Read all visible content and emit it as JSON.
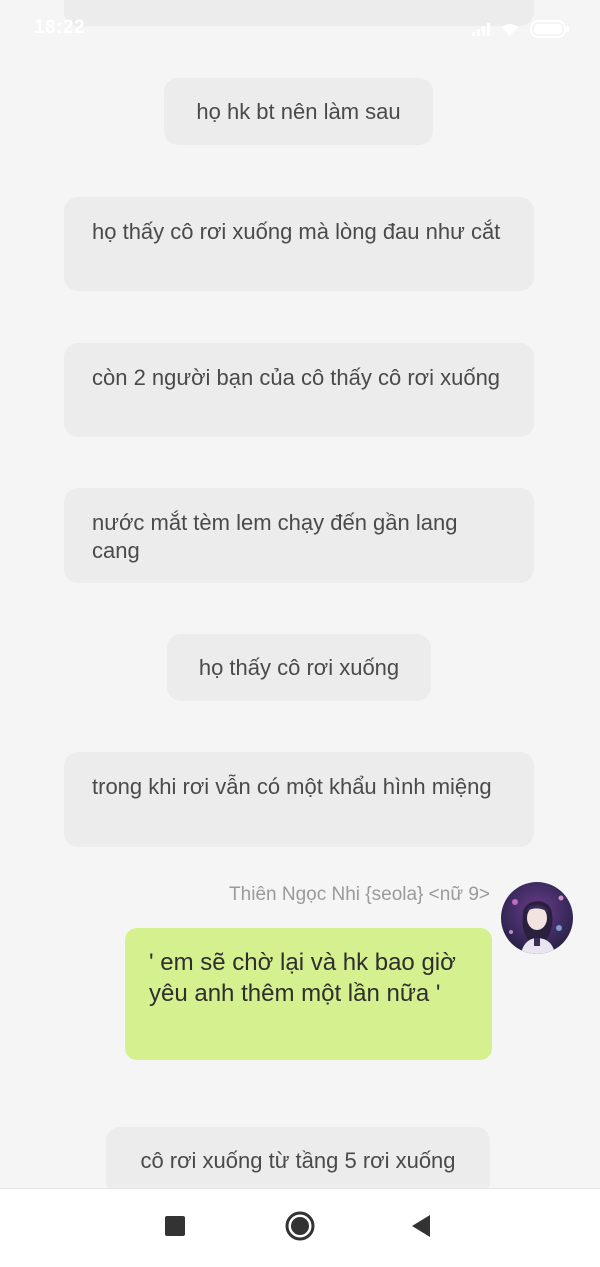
{
  "status_bar": {
    "time": "18:22",
    "signal_icon": "signal-icon",
    "wifi_icon": "wifi-icon",
    "battery_icon": "battery-icon"
  },
  "chat": {
    "messages": [
      {
        "text": "họ hk bt nên làm sau"
      },
      {
        "text": "họ thấy cô rơi xuống mà lòng đau như cắt"
      },
      {
        "text": "còn 2 người bạn của cô thấy cô rơi xuống"
      },
      {
        "text": "nước mắt tèm lem chạy đến gần lang cang"
      },
      {
        "text": "họ thấy cô rơi xuống"
      },
      {
        "text": "trong khi rơi vẫn có một khẩu hình miệng"
      },
      {
        "sender": "Thiên Ngọc Nhi {seola} <nữ 9>",
        "text": "' em sẽ chờ lại và hk bao giờ yêu anh thêm một lần nữa '"
      },
      {
        "text": "cô rơi xuống từ tầng 5 rơi xuống"
      }
    ],
    "my_bubble_color": "#d5f08f",
    "bubble_color": "#ececec"
  },
  "nav_bar": {
    "recents_icon": "square-icon",
    "home_icon": "circle-icon",
    "back_icon": "back-triangle-icon"
  }
}
